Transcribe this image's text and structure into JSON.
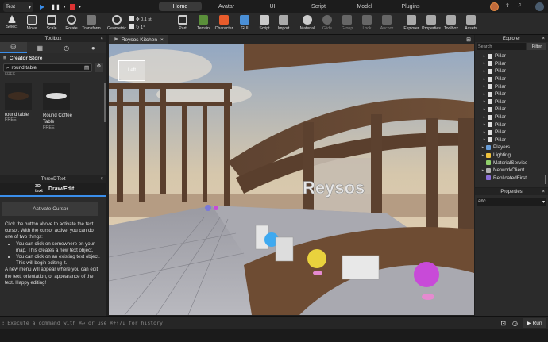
{
  "topbar": {
    "project": "Test",
    "tabs": [
      "Home",
      "Avatar",
      "UI",
      "Script",
      "Model",
      "Plugins"
    ],
    "active_tab": "Home"
  },
  "ribbon": {
    "buttons": [
      {
        "label": "Select",
        "icon": "cursor-icon"
      },
      {
        "label": "Move",
        "icon": "move-icon"
      },
      {
        "label": "Scale",
        "icon": "scale-icon"
      },
      {
        "label": "Rotate",
        "icon": "rotate-icon"
      },
      {
        "label": "Transform",
        "icon": "transform-icon"
      },
      {
        "label": "Geometric",
        "icon": "geometric-icon"
      },
      {
        "label": "Part",
        "icon": "part-icon"
      },
      {
        "label": "Terrain",
        "icon": "terrain-icon"
      },
      {
        "label": "Character",
        "icon": "character-icon"
      },
      {
        "label": "GUI",
        "icon": "gui-icon"
      },
      {
        "label": "Script",
        "icon": "script-icon"
      },
      {
        "label": "Import",
        "icon": "import-icon"
      },
      {
        "label": "Material",
        "icon": "material-icon"
      },
      {
        "label": "Glide",
        "icon": "glide-icon"
      },
      {
        "label": "Group",
        "icon": "group-icon"
      },
      {
        "label": "Lock",
        "icon": "lock-icon"
      },
      {
        "label": "Anchor",
        "icon": "anchor-icon"
      },
      {
        "label": "Explorer",
        "icon": "explorer-icon"
      },
      {
        "label": "Properties",
        "icon": "properties-icon"
      },
      {
        "label": "Toolbox",
        "icon": "toolbox-icon"
      },
      {
        "label": "Assets",
        "icon": "assets-icon"
      }
    ],
    "move_snap": "0.1 st.",
    "rotate_snap": "1°"
  },
  "toolbox": {
    "title": "Toolbox",
    "store_label": "Creator Store",
    "search_value": "round table",
    "items": [
      {
        "name": "round table",
        "price": "FREE"
      },
      {
        "name": "Round Coffee Table",
        "price": "FREE"
      }
    ],
    "top_free": "FREE"
  },
  "threedtext": {
    "header": "ThreeDText",
    "badge": "3D text",
    "mode": "Draw/Edit",
    "activate_label": "Activate Cursor",
    "para1": "Click the button above to activate the text cursor. With the cursor active, you can do one of two things:",
    "bullet1": "You can click on somewhere on your map. This creates a new text object.",
    "bullet2": "You can click on an existing text object. This will begin editing it.",
    "para2": "A new menu will appear where you can edit the text, orientation, or appearance of the text. Happy editing!"
  },
  "viewport": {
    "tab_label": "Reysos Kitchen",
    "sign_text": "Reysos",
    "cube_label": "Left"
  },
  "explorer": {
    "title": "Explorer",
    "search_placeholder": "Search",
    "filter_label": "Filter",
    "rows": [
      {
        "label": "Pillar",
        "type": "model"
      },
      {
        "label": "Pillar",
        "type": "model"
      },
      {
        "label": "Pillar",
        "type": "model"
      },
      {
        "label": "Pillar",
        "type": "model"
      },
      {
        "label": "Pillar",
        "type": "model"
      },
      {
        "label": "Pillar",
        "type": "model"
      },
      {
        "label": "Pillar",
        "type": "model"
      },
      {
        "label": "Pillar",
        "type": "model"
      },
      {
        "label": "Pillar",
        "type": "model"
      },
      {
        "label": "Pillar",
        "type": "model"
      },
      {
        "label": "Pillar",
        "type": "model"
      },
      {
        "label": "Pillar",
        "type": "model"
      },
      {
        "label": "Players",
        "type": "players"
      },
      {
        "label": "Lighting",
        "type": "lighting"
      },
      {
        "label": "MaterialService",
        "type": "material"
      },
      {
        "label": "NetworkClient",
        "type": "network"
      },
      {
        "label": "ReplicatedFirst",
        "type": "replicated"
      }
    ]
  },
  "properties": {
    "title": "Properties",
    "filter_value": "anc"
  },
  "command": {
    "placeholder": "Execute a command with ⌘↵ or use ⌘+↑/↓ for history",
    "run_label": "Run"
  },
  "colors": {
    "accent": "#3a8eeb",
    "panel": "#2b2b2b"
  }
}
